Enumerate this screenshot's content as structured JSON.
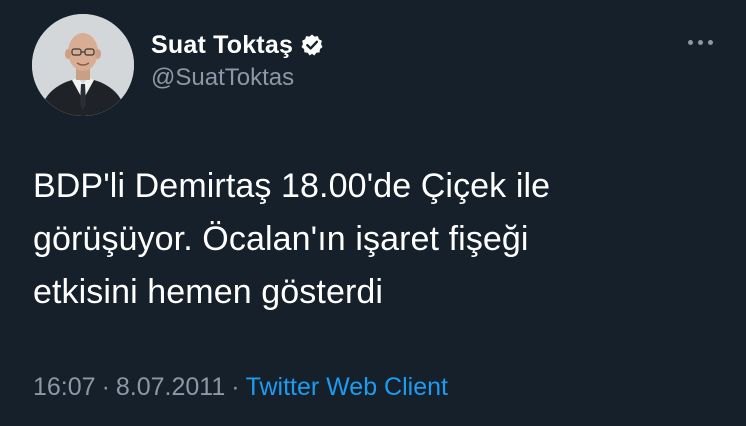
{
  "author": {
    "display_name": "Suat Toktaş",
    "handle": "@SuatToktas",
    "verified": true
  },
  "tweet": {
    "text": "BDP'li Demirtaş 18.00'de Çiçek ile\ngörüşüyor. Öcalan'ın işaret fişeği\netkisini hemen gösterdi"
  },
  "meta": {
    "time": "16:07",
    "separator": "·",
    "date": "8.07.2011",
    "client": "Twitter Web Client"
  },
  "icons": {
    "verified": "verified-badge-icon",
    "more": "more-options-icon"
  },
  "colors": {
    "background": "#15202b",
    "text_primary": "#ffffff",
    "text_secondary": "#8b98a5",
    "link": "#1d9bf0"
  }
}
